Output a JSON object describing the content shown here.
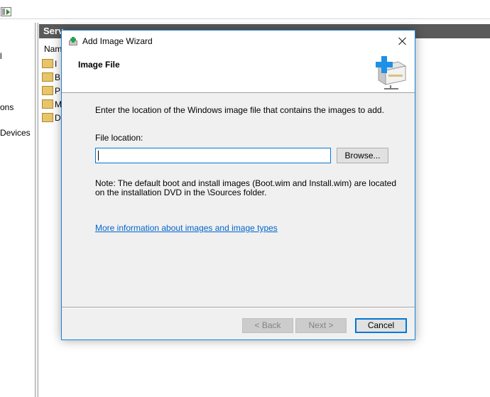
{
  "background": {
    "left_items": [
      "l",
      "ons",
      "Devices"
    ],
    "panel_title": "Serv",
    "column_header": "Nam",
    "rows": [
      "I",
      "B",
      "P",
      "M",
      "D"
    ]
  },
  "dialog": {
    "title": "Add Image Wizard",
    "page_title": "Image File",
    "instruction": "Enter the location of the Windows image file that contains the images to add.",
    "field_label": "File location:",
    "location_value": "",
    "browse_label": "Browse...",
    "note": "Note: The default boot and install images (Boot.wim and Install.wim) are located on the installation DVD in the \\Sources folder.",
    "more_info_link": "More information about images and image types",
    "back_label": "< Back",
    "next_label": "Next >",
    "cancel_label": "Cancel"
  },
  "colors": {
    "accent": "#0078d7",
    "link": "#0066cc",
    "dialog_body": "#f0f0f0"
  }
}
